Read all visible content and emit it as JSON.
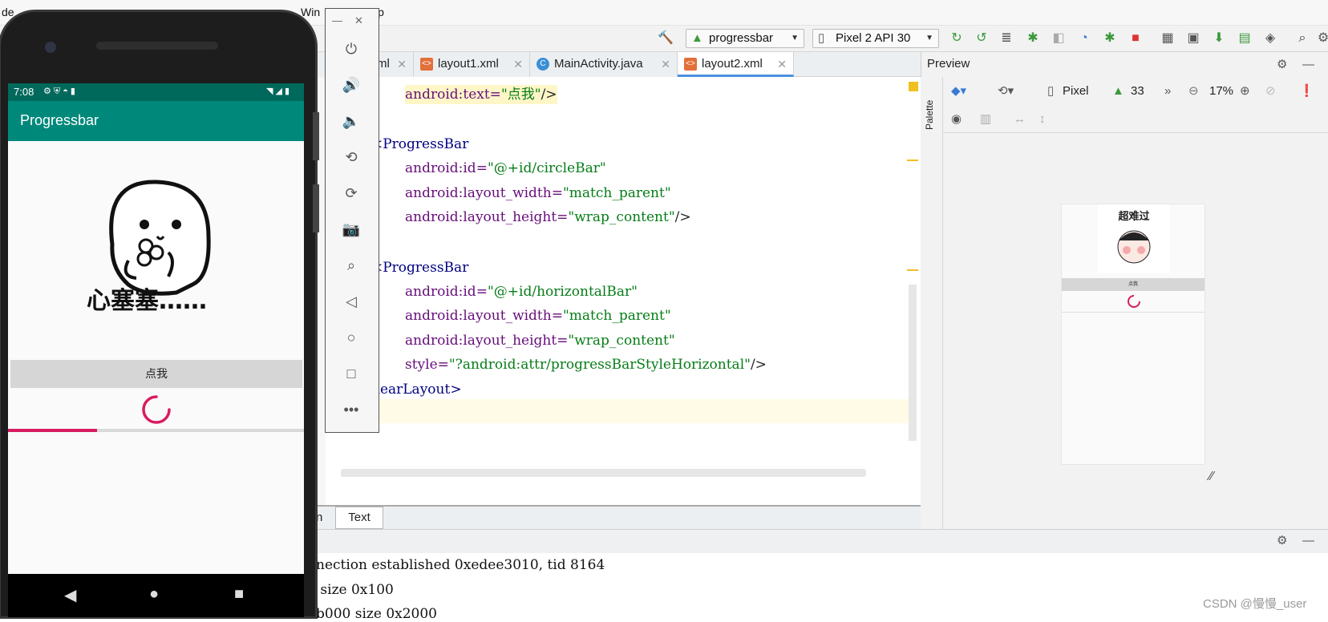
{
  "menubar": {
    "partial_left": "de",
    "window_menu": "Win",
    "help_menu": "lp"
  },
  "toolbar": {
    "run_config": "progressbar",
    "device": "Pixel 2 API 30"
  },
  "editor_tabs": [
    {
      "label": "ml",
      "type": "xml"
    },
    {
      "label": "layout1.xml",
      "type": "xml"
    },
    {
      "label": "MainActivity.java",
      "type": "java"
    },
    {
      "label": "layout2.xml",
      "type": "xml",
      "active": true
    }
  ],
  "code": {
    "line1_attr": "android:text=",
    "line1_val": "\"点我\"",
    "line1_end": "/>",
    "pb1_open": "<ProgressBar",
    "pb1_id_attr": "android:id=",
    "pb1_id_val": "\"@+id/circleBar\"",
    "pb1_w_attr": "android:layout_width=",
    "pb1_w_val": "\"match_parent\"",
    "pb1_h_attr": "android:layout_height=",
    "pb1_h_val": "\"wrap_content\"",
    "pb1_end": "/>",
    "pb2_open": "<ProgressBar",
    "pb2_id_attr": "android:id=",
    "pb2_id_val": "\"@+id/horizontalBar\"",
    "pb2_w_attr": "android:layout_width=",
    "pb2_w_val": "\"match_parent\"",
    "pb2_h_attr": "android:layout_height=",
    "pb2_h_val": "\"wrap_content\"",
    "pb2_style_attr": "style=",
    "pb2_style_val": "\"?android:attr/progressBarStyleHorizontal\"",
    "pb2_end": "/>",
    "close_tag": "nearLayout>"
  },
  "bottom_tabs": {
    "design_partial": "n",
    "text": "Text"
  },
  "preview": {
    "title": "Preview",
    "palette": "Palette",
    "device": "Pixel",
    "api": "33",
    "zoom": "17%",
    "mini_caption": "超难过",
    "mini_button": "点我"
  },
  "console": {
    "line1": "nection established 0xedee3010, tid 8164",
    "line2": " size 0x100",
    "line3": "b000 size 0x2000"
  },
  "watermark": "CSDN @慢慢_user",
  "phone": {
    "time": "7:08",
    "app_title": "Progressbar",
    "image_caption": "心塞塞……",
    "button_label": "点我",
    "progress": 0.3
  },
  "colors": {
    "app_bar": "#00897b",
    "status_bar": "#00695c",
    "accent": "#d81b60"
  }
}
